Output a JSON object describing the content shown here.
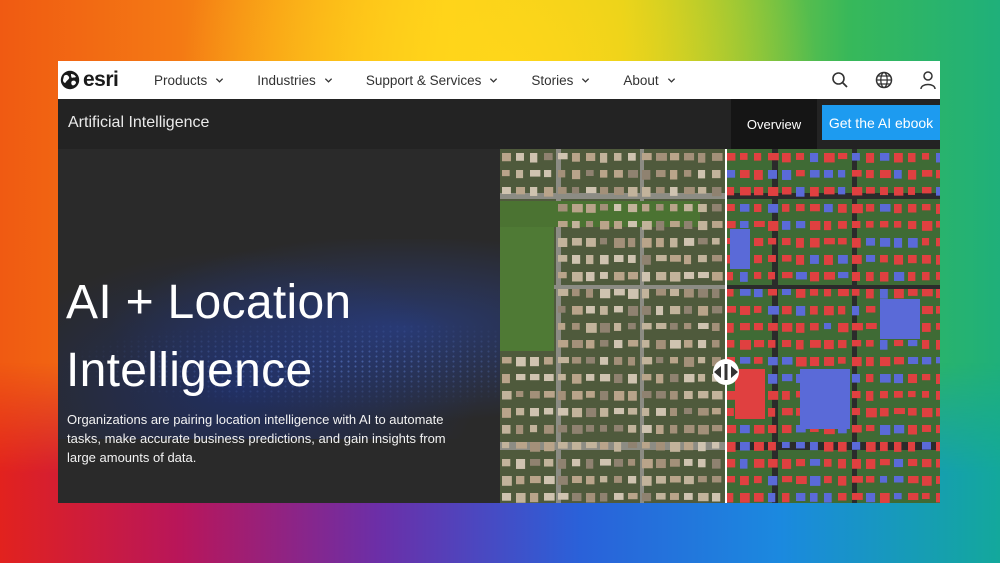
{
  "brand": {
    "logo_text": "esri"
  },
  "nav": {
    "items": [
      {
        "label": "Products"
      },
      {
        "label": "Industries"
      },
      {
        "label": "Support & Services"
      },
      {
        "label": "Stories"
      },
      {
        "label": "About"
      }
    ],
    "icons": [
      "search-icon",
      "globe-icon",
      "user-icon"
    ]
  },
  "subnav": {
    "title": "Artificial Intelligence",
    "overview": "Overview",
    "cta": "Get the AI ebook"
  },
  "hero": {
    "headline_line1": "AI + Location",
    "headline_line2": "Intelligence",
    "description": "Organizations are pairing location intelligence with AI to automate tasks, make accurate business predictions, and gain insights from large amounts of data."
  },
  "colors": {
    "accent": "#1d9bf0",
    "subnav_bg": "#232323",
    "hero_bg": "#2a2a2a",
    "roof_detected": "#e04040",
    "pavement_detected": "#5a6ad8"
  }
}
